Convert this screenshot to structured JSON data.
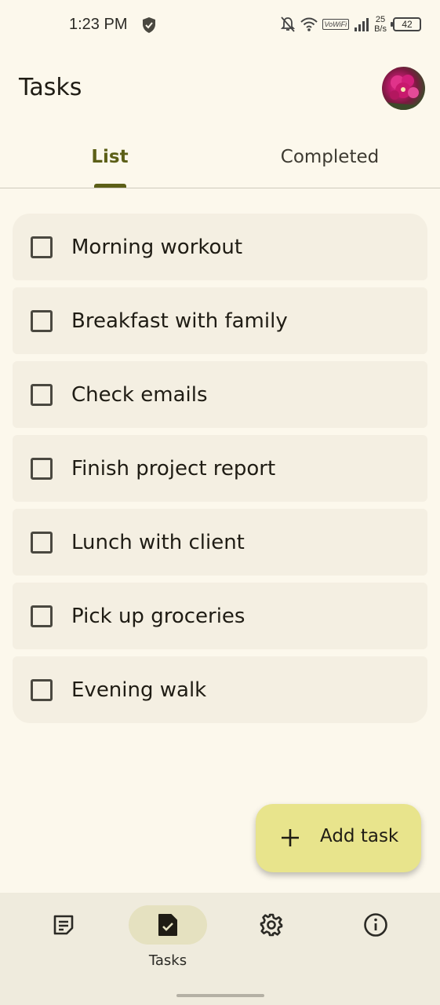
{
  "status_bar": {
    "time": "1:23 PM",
    "network_speed_value": "25",
    "network_speed_unit": "B/s",
    "battery": "42",
    "volte": "VoWiFi"
  },
  "app_bar": {
    "title": "Tasks"
  },
  "tabs": [
    {
      "label": "List",
      "selected": true
    },
    {
      "label": "Completed",
      "selected": false
    }
  ],
  "tasks": [
    {
      "label": "Morning workout",
      "checked": false
    },
    {
      "label": "Breakfast with family",
      "checked": false
    },
    {
      "label": "Check emails",
      "checked": false
    },
    {
      "label": "Finish project report",
      "checked": false
    },
    {
      "label": "Lunch with client",
      "checked": false
    },
    {
      "label": "Pick up groceries",
      "checked": false
    },
    {
      "label": "Evening walk",
      "checked": false
    }
  ],
  "fab": {
    "label": "Add task",
    "icon": "plus-icon"
  },
  "bottom_nav": {
    "items": [
      {
        "icon": "notes-icon",
        "label": ""
      },
      {
        "icon": "task-check-icon",
        "label": "Tasks",
        "active": true
      },
      {
        "icon": "settings-gear-icon",
        "label": ""
      },
      {
        "icon": "info-icon",
        "label": ""
      }
    ]
  },
  "colors": {
    "background": "#fcf8ec",
    "accent": "#5c5f17",
    "task_card": "#f4efe2",
    "fab": "#e8e48c",
    "nav_bar": "#efebdd",
    "nav_active_pill": "#e5e1c0"
  }
}
